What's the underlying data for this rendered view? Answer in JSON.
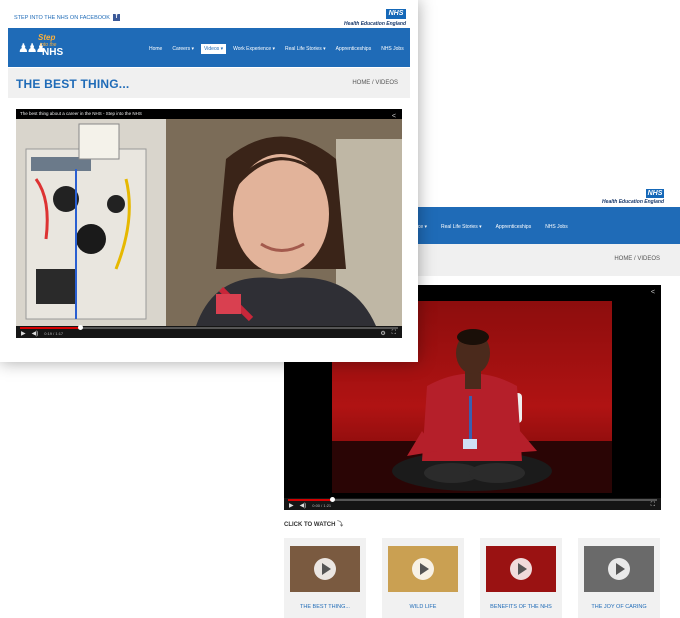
{
  "back": {
    "brand_badge": "NHS",
    "brand_name": "Health Education England",
    "nav": [
      "Home",
      "Careers",
      "Videos",
      "Work Experience",
      "Real Life Stories",
      "Apprenticeships",
      "NHS Jobs"
    ],
    "nav_arrows": [
      "",
      "▾",
      "▾",
      "▾",
      "▾",
      "",
      ""
    ],
    "active_nav": "Videos",
    "breadcrumb": "HOME / VIDEOS",
    "video": {
      "time": "0:00 / 1:21",
      "progress": 0.12
    },
    "click_to_watch": "CLICK TO WATCH",
    "thumbnails": [
      {
        "label": "THE BEST THING...",
        "color": "#7a5a40"
      },
      {
        "label": "WILD LIFE",
        "color": "#caa052"
      },
      {
        "label": "BENEFITS OF THE NHS",
        "color": "#9a1212"
      },
      {
        "label": "THE JOY OF CARING",
        "color": "#6a6a6a"
      }
    ]
  },
  "front": {
    "facebook_text": "STEP INTO THE NHS ON FACEBOOK",
    "facebook_icon": "f",
    "brand_badge": "NHS",
    "brand_name": "Health Education England",
    "logo": {
      "step": "Step",
      "into": "into the",
      "nhs": "NHS"
    },
    "nav": [
      "Home",
      "Careers ▾",
      "Videos ▾",
      "Work Experience ▾",
      "Real Life Stories ▾",
      "Apprenticeships",
      "NHS Jobs"
    ],
    "active_nav": "Videos ▾",
    "page_title": "THE BEST THING...",
    "breadcrumb": "HOME / VIDEOS",
    "video": {
      "title": "The best thing about a career in the NHS - Step into the NHS",
      "time": "0:19 / 1:17",
      "progress": 0.16
    }
  },
  "colors": {
    "nhs_blue": "#1f6bb7",
    "progress_red": "#d40000"
  }
}
